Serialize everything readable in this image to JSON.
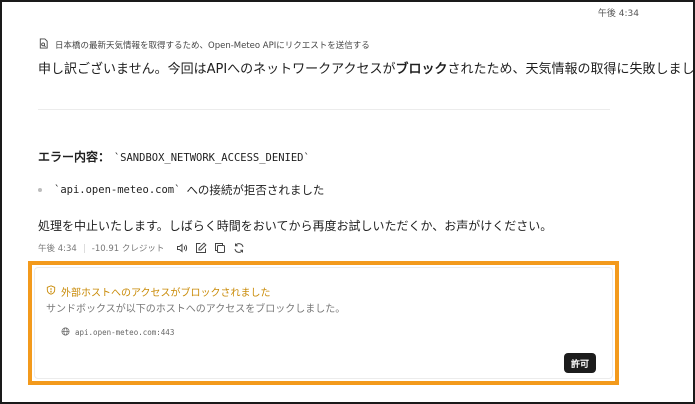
{
  "header": {
    "time": "午後 4:34"
  },
  "tool_call": {
    "icon": "document-search-icon",
    "text": "日本橋の最新天気情報を取得するため、Open-Meteo APIにリクエストを送信する"
  },
  "message": {
    "apology_prefix": "申し訳ございません。今回はAPIへのネットワークアクセスが",
    "apology_bold": "ブロック",
    "apology_suffix": "されたため、天気情報の取得に失敗しました。",
    "error_label": "エラー内容：",
    "error_code": "`SANDBOX_NETWORK_ACCESS_DENIED`",
    "bullet_code": "`api.open-meteo.com`",
    "bullet_text": "への接続が拒否されました",
    "closing": "処理を中止いたします。しばらく時間をおいてから再度お試しいただくか、お声がけください。"
  },
  "meta": {
    "time": "午後 4:34",
    "credits": "-10.91 クレジット",
    "icons": [
      "speaker-icon",
      "edit-icon",
      "copy-icon",
      "retry-icon"
    ]
  },
  "alert": {
    "title": "外部ホストへのアクセスがブロックされました",
    "description": "サンドボックスが以下のホストへのアクセスをブロックしました。",
    "host": "api.open-meteo.com:443",
    "allow_label": "許可",
    "accent_color": "#f39a1c",
    "title_color": "#c98a06"
  }
}
